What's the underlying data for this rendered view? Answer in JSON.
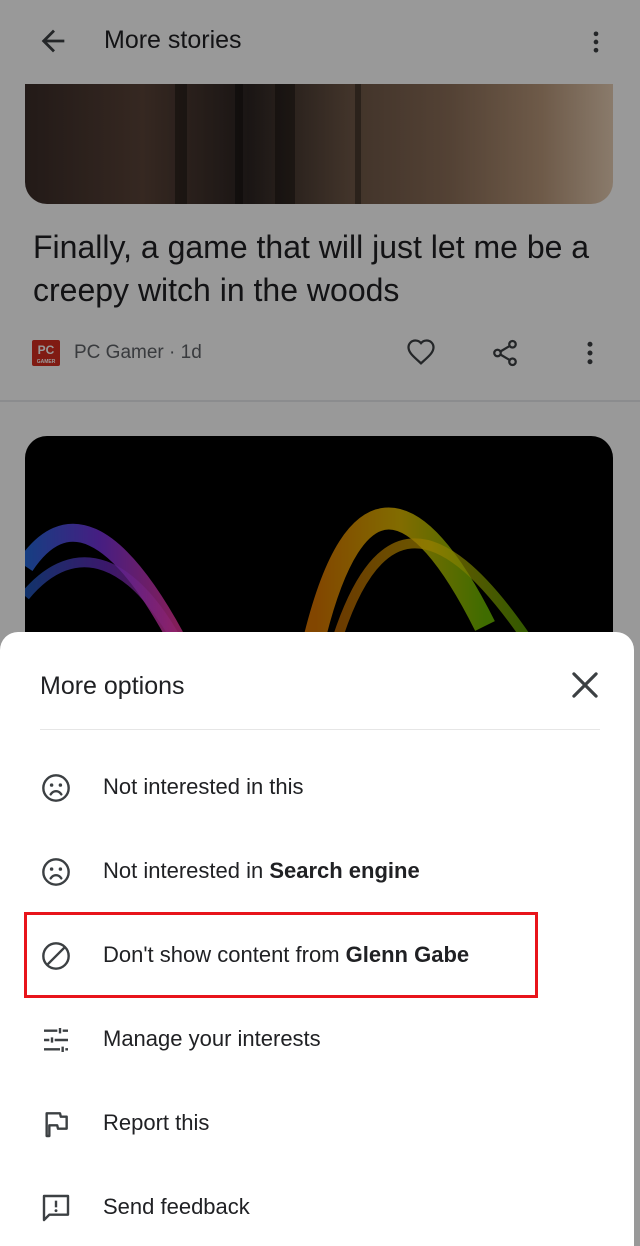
{
  "header": {
    "title": "More stories",
    "back_icon": "arrow-back-icon",
    "menu_icon": "more-vert-icon"
  },
  "story": {
    "headline": "Finally, a game that will just let me be a creepy witch in the woods",
    "source_logo": "PC",
    "source_logo_sub": "GAMER",
    "source_meta": "PC Gamer · 1d",
    "actions": [
      "heart-icon",
      "share-icon",
      "more-vert-icon"
    ]
  },
  "sheet": {
    "title": "More options",
    "close_icon": "close-icon",
    "options": [
      {
        "icon": "sad-face-icon",
        "text": "Not interested in this",
        "bold": ""
      },
      {
        "icon": "sad-face-icon",
        "text": "Not interested in ",
        "bold": "Search engine"
      },
      {
        "icon": "block-icon",
        "text": "Don't show content from ",
        "bold": "Glenn Gabe"
      },
      {
        "icon": "tune-icon",
        "text": "Manage your interests",
        "bold": ""
      },
      {
        "icon": "flag-icon",
        "text": "Report this",
        "bold": ""
      },
      {
        "icon": "feedback-icon",
        "text": "Send feedback",
        "bold": ""
      }
    ]
  },
  "colors": {
    "highlight": "#e8141b",
    "source_logo_bg": "#d62d20",
    "scrim": "rgba(0,0,0,0.40)"
  }
}
